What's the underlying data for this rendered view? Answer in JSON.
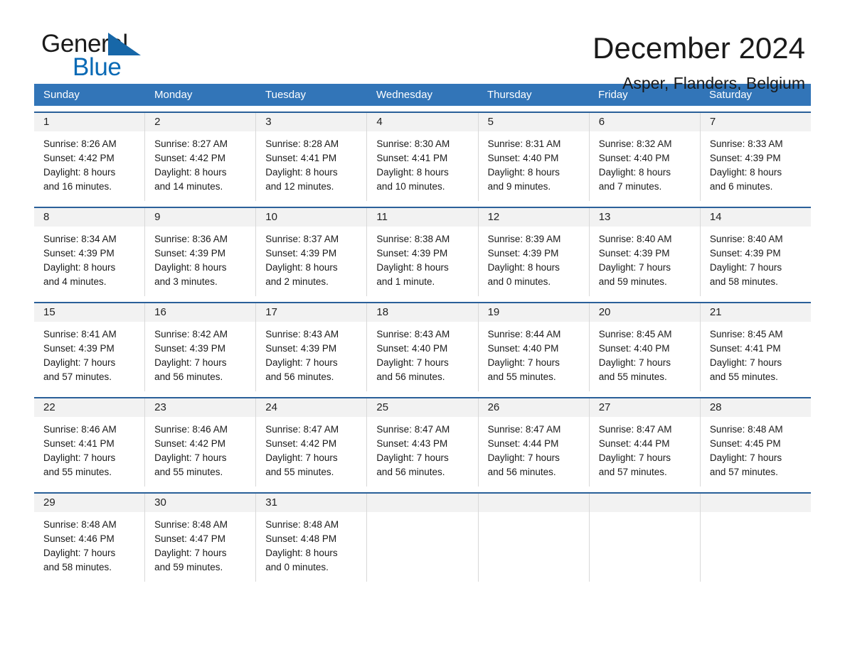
{
  "brand": {
    "name_part1": "General",
    "name_part2": "Blue",
    "triangle_color": "#1767a8",
    "blue_color": "#0a6ab5"
  },
  "header": {
    "title": "December 2024",
    "subtitle": "Asper, Flanders, Belgium"
  },
  "theme": {
    "header_bg": "#3275b8",
    "week_rule": "#2a6099",
    "day_number_bg": "#f2f2f2"
  },
  "weekdays": [
    "Sunday",
    "Monday",
    "Tuesday",
    "Wednesday",
    "Thursday",
    "Friday",
    "Saturday"
  ],
  "weeks": [
    [
      {
        "day": "1",
        "sunrise": "Sunrise: 8:26 AM",
        "sunset": "Sunset: 4:42 PM",
        "daylight1": "Daylight: 8 hours",
        "daylight2": "and 16 minutes."
      },
      {
        "day": "2",
        "sunrise": "Sunrise: 8:27 AM",
        "sunset": "Sunset: 4:42 PM",
        "daylight1": "Daylight: 8 hours",
        "daylight2": "and 14 minutes."
      },
      {
        "day": "3",
        "sunrise": "Sunrise: 8:28 AM",
        "sunset": "Sunset: 4:41 PM",
        "daylight1": "Daylight: 8 hours",
        "daylight2": "and 12 minutes."
      },
      {
        "day": "4",
        "sunrise": "Sunrise: 8:30 AM",
        "sunset": "Sunset: 4:41 PM",
        "daylight1": "Daylight: 8 hours",
        "daylight2": "and 10 minutes."
      },
      {
        "day": "5",
        "sunrise": "Sunrise: 8:31 AM",
        "sunset": "Sunset: 4:40 PM",
        "daylight1": "Daylight: 8 hours",
        "daylight2": "and 9 minutes."
      },
      {
        "day": "6",
        "sunrise": "Sunrise: 8:32 AM",
        "sunset": "Sunset: 4:40 PM",
        "daylight1": "Daylight: 8 hours",
        "daylight2": "and 7 minutes."
      },
      {
        "day": "7",
        "sunrise": "Sunrise: 8:33 AM",
        "sunset": "Sunset: 4:39 PM",
        "daylight1": "Daylight: 8 hours",
        "daylight2": "and 6 minutes."
      }
    ],
    [
      {
        "day": "8",
        "sunrise": "Sunrise: 8:34 AM",
        "sunset": "Sunset: 4:39 PM",
        "daylight1": "Daylight: 8 hours",
        "daylight2": "and 4 minutes."
      },
      {
        "day": "9",
        "sunrise": "Sunrise: 8:36 AM",
        "sunset": "Sunset: 4:39 PM",
        "daylight1": "Daylight: 8 hours",
        "daylight2": "and 3 minutes."
      },
      {
        "day": "10",
        "sunrise": "Sunrise: 8:37 AM",
        "sunset": "Sunset: 4:39 PM",
        "daylight1": "Daylight: 8 hours",
        "daylight2": "and 2 minutes."
      },
      {
        "day": "11",
        "sunrise": "Sunrise: 8:38 AM",
        "sunset": "Sunset: 4:39 PM",
        "daylight1": "Daylight: 8 hours",
        "daylight2": "and 1 minute."
      },
      {
        "day": "12",
        "sunrise": "Sunrise: 8:39 AM",
        "sunset": "Sunset: 4:39 PM",
        "daylight1": "Daylight: 8 hours",
        "daylight2": "and 0 minutes."
      },
      {
        "day": "13",
        "sunrise": "Sunrise: 8:40 AM",
        "sunset": "Sunset: 4:39 PM",
        "daylight1": "Daylight: 7 hours",
        "daylight2": "and 59 minutes."
      },
      {
        "day": "14",
        "sunrise": "Sunrise: 8:40 AM",
        "sunset": "Sunset: 4:39 PM",
        "daylight1": "Daylight: 7 hours",
        "daylight2": "and 58 minutes."
      }
    ],
    [
      {
        "day": "15",
        "sunrise": "Sunrise: 8:41 AM",
        "sunset": "Sunset: 4:39 PM",
        "daylight1": "Daylight: 7 hours",
        "daylight2": "and 57 minutes."
      },
      {
        "day": "16",
        "sunrise": "Sunrise: 8:42 AM",
        "sunset": "Sunset: 4:39 PM",
        "daylight1": "Daylight: 7 hours",
        "daylight2": "and 56 minutes."
      },
      {
        "day": "17",
        "sunrise": "Sunrise: 8:43 AM",
        "sunset": "Sunset: 4:39 PM",
        "daylight1": "Daylight: 7 hours",
        "daylight2": "and 56 minutes."
      },
      {
        "day": "18",
        "sunrise": "Sunrise: 8:43 AM",
        "sunset": "Sunset: 4:40 PM",
        "daylight1": "Daylight: 7 hours",
        "daylight2": "and 56 minutes."
      },
      {
        "day": "19",
        "sunrise": "Sunrise: 8:44 AM",
        "sunset": "Sunset: 4:40 PM",
        "daylight1": "Daylight: 7 hours",
        "daylight2": "and 55 minutes."
      },
      {
        "day": "20",
        "sunrise": "Sunrise: 8:45 AM",
        "sunset": "Sunset: 4:40 PM",
        "daylight1": "Daylight: 7 hours",
        "daylight2": "and 55 minutes."
      },
      {
        "day": "21",
        "sunrise": "Sunrise: 8:45 AM",
        "sunset": "Sunset: 4:41 PM",
        "daylight1": "Daylight: 7 hours",
        "daylight2": "and 55 minutes."
      }
    ],
    [
      {
        "day": "22",
        "sunrise": "Sunrise: 8:46 AM",
        "sunset": "Sunset: 4:41 PM",
        "daylight1": "Daylight: 7 hours",
        "daylight2": "and 55 minutes."
      },
      {
        "day": "23",
        "sunrise": "Sunrise: 8:46 AM",
        "sunset": "Sunset: 4:42 PM",
        "daylight1": "Daylight: 7 hours",
        "daylight2": "and 55 minutes."
      },
      {
        "day": "24",
        "sunrise": "Sunrise: 8:47 AM",
        "sunset": "Sunset: 4:42 PM",
        "daylight1": "Daylight: 7 hours",
        "daylight2": "and 55 minutes."
      },
      {
        "day": "25",
        "sunrise": "Sunrise: 8:47 AM",
        "sunset": "Sunset: 4:43 PM",
        "daylight1": "Daylight: 7 hours",
        "daylight2": "and 56 minutes."
      },
      {
        "day": "26",
        "sunrise": "Sunrise: 8:47 AM",
        "sunset": "Sunset: 4:44 PM",
        "daylight1": "Daylight: 7 hours",
        "daylight2": "and 56 minutes."
      },
      {
        "day": "27",
        "sunrise": "Sunrise: 8:47 AM",
        "sunset": "Sunset: 4:44 PM",
        "daylight1": "Daylight: 7 hours",
        "daylight2": "and 57 minutes."
      },
      {
        "day": "28",
        "sunrise": "Sunrise: 8:48 AM",
        "sunset": "Sunset: 4:45 PM",
        "daylight1": "Daylight: 7 hours",
        "daylight2": "and 57 minutes."
      }
    ],
    [
      {
        "day": "29",
        "sunrise": "Sunrise: 8:48 AM",
        "sunset": "Sunset: 4:46 PM",
        "daylight1": "Daylight: 7 hours",
        "daylight2": "and 58 minutes."
      },
      {
        "day": "30",
        "sunrise": "Sunrise: 8:48 AM",
        "sunset": "Sunset: 4:47 PM",
        "daylight1": "Daylight: 7 hours",
        "daylight2": "and 59 minutes."
      },
      {
        "day": "31",
        "sunrise": "Sunrise: 8:48 AM",
        "sunset": "Sunset: 4:48 PM",
        "daylight1": "Daylight: 8 hours",
        "daylight2": "and 0 minutes."
      },
      {
        "day": "",
        "sunrise": "",
        "sunset": "",
        "daylight1": "",
        "daylight2": ""
      },
      {
        "day": "",
        "sunrise": "",
        "sunset": "",
        "daylight1": "",
        "daylight2": ""
      },
      {
        "day": "",
        "sunrise": "",
        "sunset": "",
        "daylight1": "",
        "daylight2": ""
      },
      {
        "day": "",
        "sunrise": "",
        "sunset": "",
        "daylight1": "",
        "daylight2": ""
      }
    ]
  ]
}
